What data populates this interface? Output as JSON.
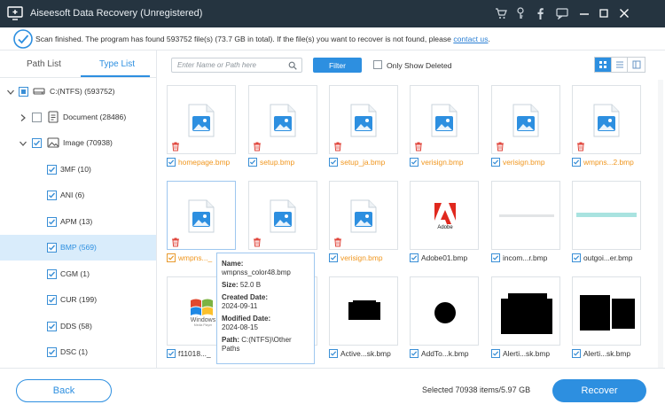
{
  "window": {
    "title": "Aiseesoft Data Recovery (Unregistered)",
    "controls": [
      "cart-icon",
      "key-icon",
      "facebook-icon",
      "feedback-icon",
      "minimize-icon",
      "maximize-icon",
      "close-icon"
    ]
  },
  "status": {
    "message": "Scan finished. The program has found 593752 file(s) (73.7 GB in total). If the file(s) you want to recover is not found, please",
    "link": "contact us",
    "suffix": "."
  },
  "tabs": {
    "path_list": "Path List",
    "type_list": "Type List",
    "active": "type_list"
  },
  "tree": {
    "root": {
      "label": "C:(NTFS) (593752)",
      "checked": "partial"
    },
    "document": {
      "label": "Document (28486)",
      "checked": false
    },
    "image": {
      "label": "Image (70938)",
      "checked": true
    },
    "types": [
      {
        "label": "3MF (10)",
        "checked": true,
        "selected": false
      },
      {
        "label": "ANI (6)",
        "checked": true,
        "selected": false
      },
      {
        "label": "APM (13)",
        "checked": true,
        "selected": false
      },
      {
        "label": "BMP (569)",
        "checked": true,
        "selected": true
      },
      {
        "label": "CGM (1)",
        "checked": true,
        "selected": false
      },
      {
        "label": "CUR (199)",
        "checked": true,
        "selected": false
      },
      {
        "label": "DDS (58)",
        "checked": true,
        "selected": false
      },
      {
        "label": "DSC (1)",
        "checked": true,
        "selected": false
      }
    ]
  },
  "toolbar": {
    "search_placeholder": "Enter Name or Path here",
    "search_value": "",
    "filter_label": "Filter",
    "show_deleted_label": "Only Show Deleted",
    "show_deleted_checked": false,
    "view_modes": [
      "thumbnail-view-icon",
      "list-view-icon",
      "detail-view-icon"
    ],
    "active_view": "thumbnail-view-icon"
  },
  "files": [
    {
      "name": "homepage.bmp",
      "deleted": true,
      "thumb": "image-file-icon"
    },
    {
      "name": "setup.bmp",
      "deleted": true,
      "thumb": "image-file-icon"
    },
    {
      "name": "setup_ja.bmp",
      "deleted": true,
      "thumb": "image-file-icon"
    },
    {
      "name": "verisign.bmp",
      "deleted": true,
      "thumb": "image-file-icon"
    },
    {
      "name": "verisign.bmp",
      "deleted": true,
      "thumb": "image-file-icon"
    },
    {
      "name": "wmpns...2.bmp",
      "deleted": true,
      "thumb": "image-file-icon"
    },
    {
      "name": "wmpns..._",
      "deleted": true,
      "thumb": "image-file-icon"
    },
    {
      "name": "",
      "deleted": true,
      "thumb": "image-file-icon"
    },
    {
      "name": "verisign.bmp",
      "deleted": true,
      "thumb": "image-file-icon"
    },
    {
      "name": "Adobe01.bmp",
      "deleted": false,
      "thumb": "adobe-logo-icon"
    },
    {
      "name": "incom...r.bmp",
      "deleted": false,
      "thumb": "thin-bar-preview"
    },
    {
      "name": "outgoi...er.bmp",
      "deleted": false,
      "thumb": "teal-bar-preview"
    },
    {
      "name": "f11018..._",
      "deleted": false,
      "thumb": "windows-logo-icon"
    },
    {
      "name": "",
      "deleted": false,
      "thumb": "none"
    },
    {
      "name": "Active...sk.bmp",
      "deleted": false,
      "thumb": "black-rect-preview"
    },
    {
      "name": "AddTo...k.bmp",
      "deleted": false,
      "thumb": "black-circle-preview"
    },
    {
      "name": "Alerti...sk.bmp",
      "deleted": false,
      "thumb": "black-shape-preview"
    },
    {
      "name": "Alerti...sk.bmp",
      "deleted": false,
      "thumb": "black-double-preview"
    }
  ],
  "tooltip": {
    "name_label": "Name:",
    "name_value": "wmpnss_color48.bmp",
    "size_label": "Size:",
    "size_value": "52.0 B",
    "created_label": "Created Date:",
    "created_value": "2024-09-11",
    "modified_label": "Modified Date:",
    "modified_value": "2024-08-15",
    "path_label": "Path:",
    "path_value": "C:(NTFS)\\Other Paths"
  },
  "thumb_text": {
    "adobe": "Adobe",
    "windows": "Windows",
    "windows_sub": "Media Player"
  },
  "footer": {
    "back_label": "Back",
    "selected_info": "Selected 70938 items/5.97 GB",
    "recover_label": "Recover"
  },
  "colors": {
    "accent": "#2d8fe0",
    "titlebar": "#253440",
    "deleted_name": "#f0961e",
    "trash": "#e0463c"
  }
}
